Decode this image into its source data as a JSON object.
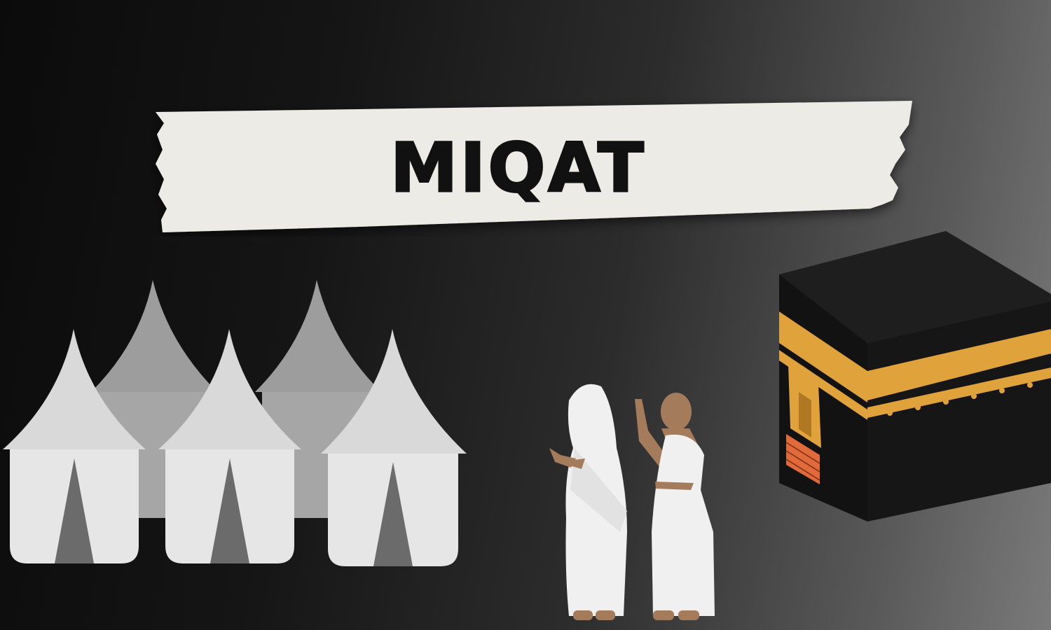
{
  "banner": {
    "title": "MIQAT"
  },
  "colors": {
    "tape": "#ecebe5",
    "tent_front": "#e6e6e6",
    "tent_back": "#9d9d9d",
    "tent_door": "#6b6b6b",
    "robe": "#f0f0f0",
    "skin": "#a47c5c",
    "kaaba_body": "#151515",
    "kaaba_gold": "#e0a23b",
    "kaaba_brick": "#e06a3a"
  },
  "icons": [
    "torn-paper-banner",
    "tents-group-icon",
    "pilgrim-figure-icon",
    "kaaba-icon"
  ]
}
